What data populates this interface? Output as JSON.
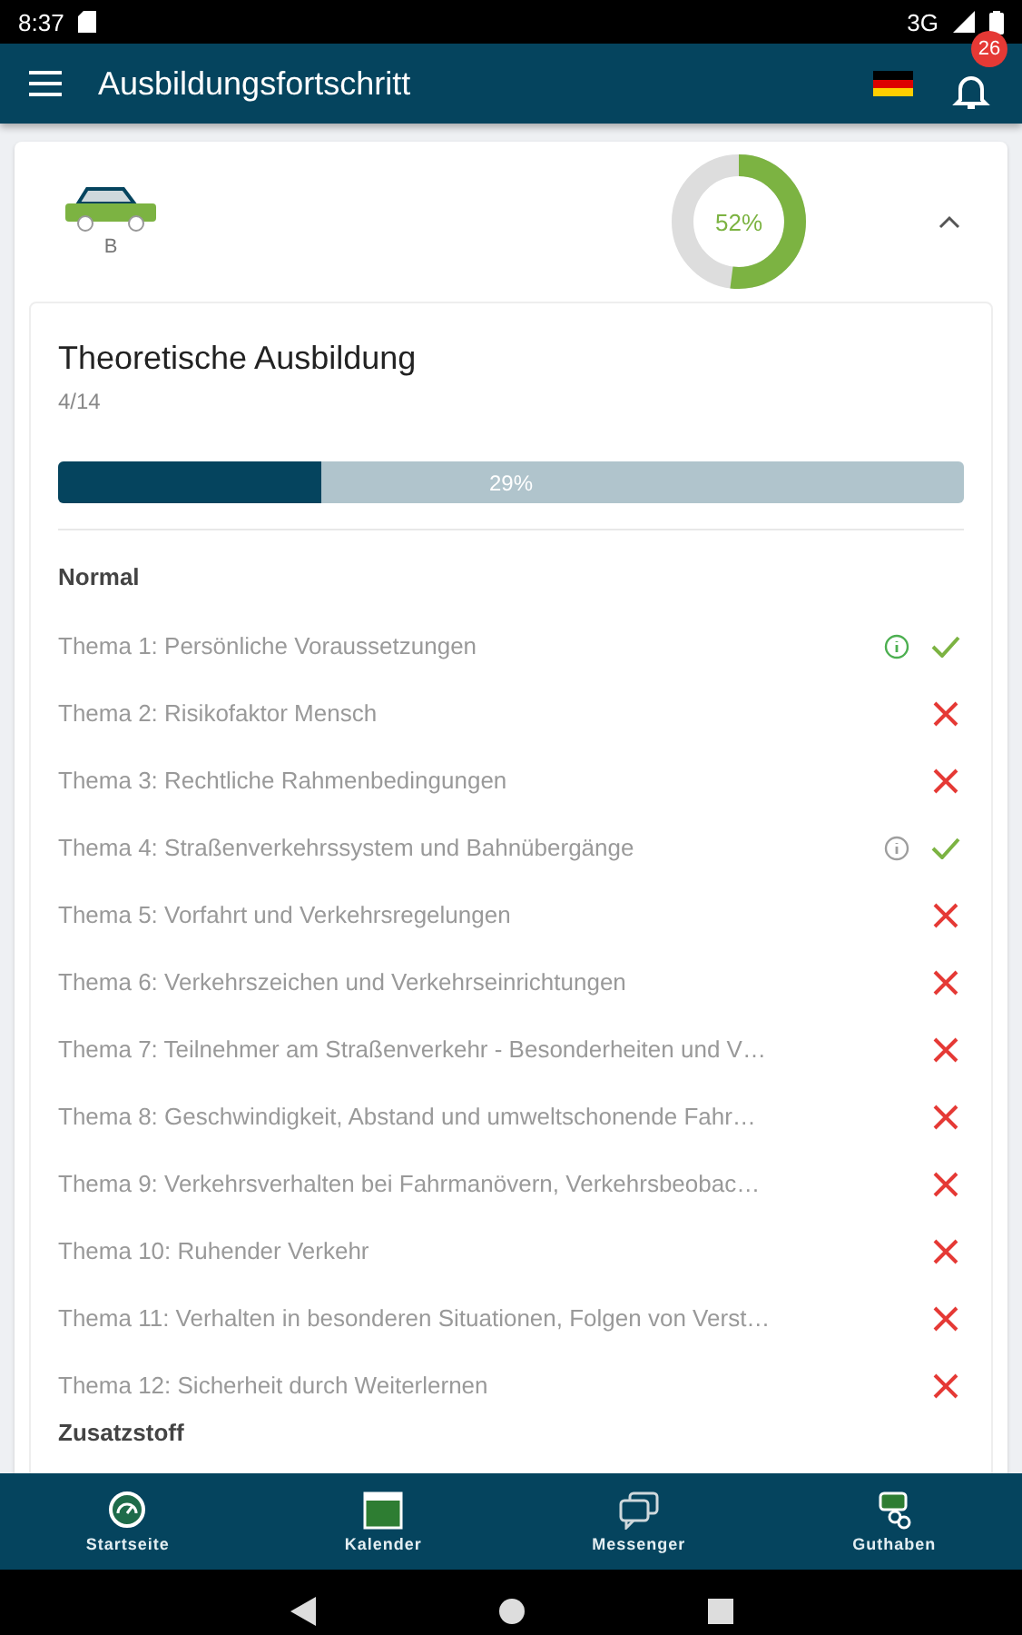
{
  "status_bar": {
    "time": "8:37",
    "network": "3G"
  },
  "app_bar": {
    "title": "Ausbildungsfortschritt",
    "notification_count": "26"
  },
  "license": {
    "class": "B",
    "level": 0.52,
    "reading": "52%",
    "expanded": true
  },
  "section": {
    "title": "Theoretische Ausbildung",
    "count": "4/14",
    "level": 0.29,
    "reading": "29%"
  },
  "groups": [
    {
      "title": "Normal",
      "topics": [
        {
          "label": "Thema 1: Persönliche Voraussetzungen",
          "done": true,
          "color": "#4caf50"
        },
        {
          "label": "Thema 2: Risikofaktor Mensch",
          "done": false
        },
        {
          "label": "Thema 3: Rechtliche Rahmenbedingungen",
          "done": false
        },
        {
          "label": "Thema 4: Straßenverkehrssystem und Bahnübergänge",
          "done": true,
          "color": "#9e9e9e"
        },
        {
          "label": "Thema 5: Vorfahrt und Verkehrsregelungen",
          "done": false
        },
        {
          "label": "Thema 6: Verkehrszeichen und Verkehrseinrichtungen",
          "done": false
        },
        {
          "label": "Thema 7: Teilnehmer am Straßenverkehr - Besonderheiten und V…",
          "done": false
        },
        {
          "label": "Thema 8: Geschwindigkeit, Abstand und umweltschonende Fahr…",
          "done": false
        },
        {
          "label": "Thema 9: Verkehrsverhalten bei Fahrmanövern, Verkehrsbeobac…",
          "done": false
        },
        {
          "label": "Thema 10: Ruhender Verkehr",
          "done": false
        },
        {
          "label": "Thema 11: Verhalten in besonderen Situationen, Folgen von Verst…",
          "done": false
        },
        {
          "label": "Thema 12: Sicherheit durch Weiterlernen",
          "done": false
        }
      ]
    },
    {
      "title": "Zusatzstoff"
    }
  ],
  "bottom_nav": [
    {
      "kind": "home",
      "label": "Startseite"
    },
    {
      "kind": "calendar",
      "label": "Kalender"
    },
    {
      "kind": "chat",
      "label": "Messenger"
    },
    {
      "kind": "credit",
      "label": "Guthaben"
    }
  ]
}
